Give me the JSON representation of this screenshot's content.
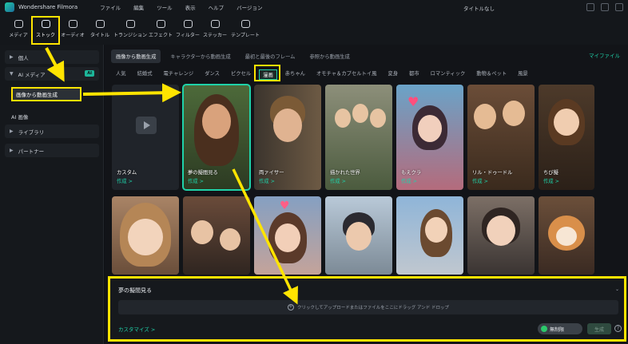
{
  "app": {
    "name": "Wondershare Filmora",
    "doc_title": "タイトルなし"
  },
  "menu": [
    "ファイル",
    "編集",
    "ツール",
    "表示",
    "ヘルプ",
    "バージョン"
  ],
  "toolbar": [
    {
      "label": "メディア",
      "icon": "media-icon"
    },
    {
      "label": "ストック",
      "icon": "stock-icon",
      "active": true
    },
    {
      "label": "オーディオ",
      "icon": "audio-icon"
    },
    {
      "label": "タイトル",
      "icon": "title-icon"
    },
    {
      "label": "トランジション",
      "icon": "transition-icon"
    },
    {
      "label": "エフェクト",
      "icon": "effect-icon"
    },
    {
      "label": "フィルター",
      "icon": "filter-icon"
    },
    {
      "label": "ステッカー",
      "icon": "sticker-icon"
    },
    {
      "label": "テンプレート",
      "icon": "template-icon"
    }
  ],
  "sidebar": {
    "items": [
      {
        "label": "個人"
      },
      {
        "label": "AI メディア",
        "badge": "AI"
      },
      {
        "label": "ライブラリ"
      },
      {
        "label": "パートナー"
      }
    ],
    "sub_items": [
      "画像から動画生成",
      "AI 画像"
    ],
    "active_sub": "画像から動画生成"
  },
  "tabs": [
    "画像から動画生成",
    "キャラクターから動画生成",
    "最初と最後のフレーム",
    "参照から動画生成"
  ],
  "my_files": "マイファイル",
  "categories": [
    "人気",
    "結婚式",
    "電チャレンジ",
    "ダンス",
    "ピクセル",
    "漫画",
    "赤ちゃん",
    "オモチャ＆カプセルトイ風",
    "変身",
    "都市",
    "ロマンティック",
    "動物＆ペット",
    "風景"
  ],
  "selected_category": "漫画",
  "cards_row1": [
    {
      "title": "カスタム",
      "action": "作成 >"
    },
    {
      "title": "夢の擬間見る",
      "action": "作成 >",
      "selected": true
    },
    {
      "title": "両ァイサー",
      "action": "作成 >"
    },
    {
      "title": "描かれた世界",
      "action": "作成 >"
    },
    {
      "title": "もえクラ",
      "action": "作成 >"
    },
    {
      "title": "リル・ドゥードル",
      "action": "作成 >"
    },
    {
      "title": "ちび擬",
      "action": "作成 >"
    }
  ],
  "bottom": {
    "title": "夢の擬間見る",
    "upload_text": "クリックしてアップロードまたはファイルをここにドラッグ アンド ドロップ",
    "customize": "カスタマイズ >",
    "free_label": "無制限",
    "generate_label": "生成"
  },
  "colors": {
    "accent": "#1fd2a9",
    "highlight": "#ffe400",
    "background": "#0f1114"
  }
}
